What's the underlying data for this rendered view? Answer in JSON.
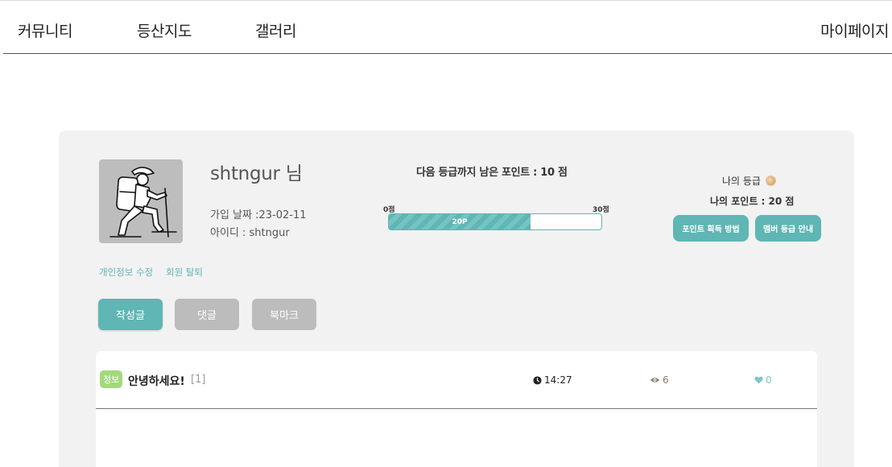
{
  "nav": {
    "community": "커뮤니티",
    "hiking_map": "등산지도",
    "gallery": "갤러리",
    "mypage": "마이페이지"
  },
  "profile": {
    "username": "shtngur 님",
    "join_date": "가입 날짜 :23-02-11",
    "user_id": "아이디 : shtngur",
    "edit_label": "개인정보 수정",
    "withdraw_label": "회원 탈퇴"
  },
  "grade": {
    "next_grade_text": "다음 등급까지 남은 포인트 : 10 점",
    "progress_min_label": "0점",
    "progress_max_label": "30점",
    "progress_value_label": "20P",
    "progress_value": 20,
    "progress_max": 30,
    "my_grade_label": "나의 등급",
    "grade_icon": "bronze-medal-icon",
    "my_points": "나의 포인트 : 20 점",
    "how_to_earn_label": "포인트 획득 방법",
    "grade_guide_label": "멤버 등급 안내"
  },
  "tabs": [
    {
      "label": "작성글",
      "active": true
    },
    {
      "label": "댓글",
      "active": false
    },
    {
      "label": "북마크",
      "active": false
    }
  ],
  "posts": [
    {
      "category": "정보",
      "title": "안녕하세요!",
      "comments": "[1]",
      "time": "14:27",
      "views": "6",
      "likes": "0"
    }
  ],
  "colors": {
    "accent": "#5fb6b4",
    "badge_info": "#a3d97a",
    "tab_inactive": "#bcbcbc",
    "card_bg": "#f2f2f2"
  }
}
